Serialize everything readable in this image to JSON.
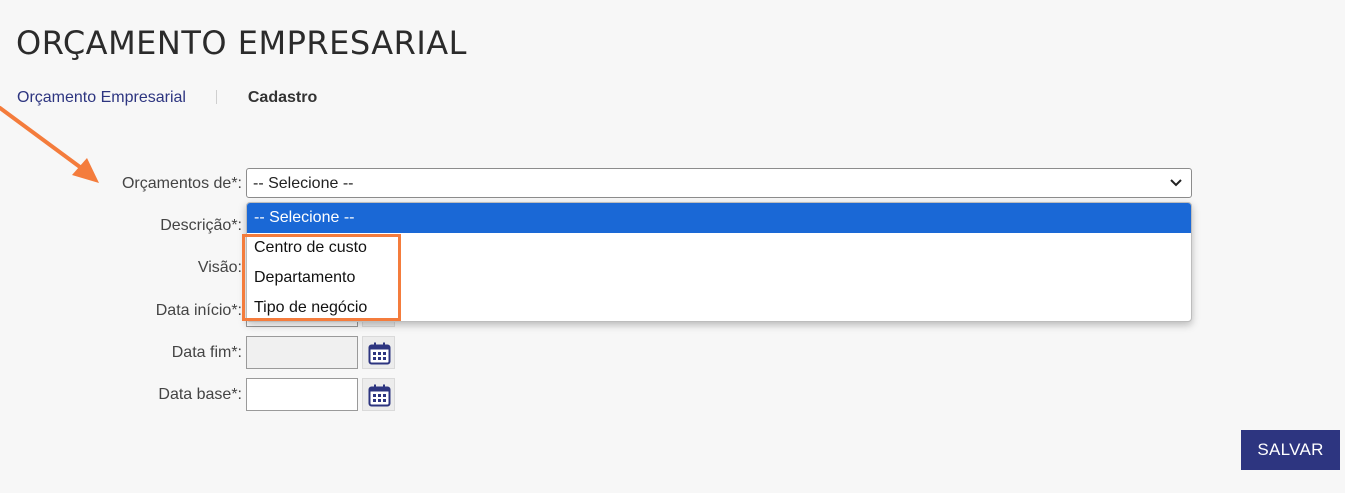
{
  "page": {
    "title": "ORÇAMENTO EMPRESARIAL"
  },
  "breadcrumb": {
    "link": "Orçamento Empresarial",
    "current": "Cadastro"
  },
  "form": {
    "orcamentos_de": {
      "label": "Orçamentos de*:",
      "value": "-- Selecione --",
      "options": [
        "-- Selecione --",
        "Centro de custo",
        "Departamento",
        "Tipo de negócio"
      ]
    },
    "descricao": {
      "label": "Descrição*:"
    },
    "visao": {
      "label": "Visão:"
    },
    "data_inicio": {
      "label": "Data início*:"
    },
    "data_fim": {
      "label": "Data fim*:"
    },
    "data_base": {
      "label": "Data base*:"
    }
  },
  "actions": {
    "save_label": "SALVAR"
  },
  "colors": {
    "accent": "#2d3580",
    "highlight": "#f47c3c",
    "selected_option": "#1a68d6"
  },
  "icons": {
    "calendar": "calendar-icon",
    "chevron": "chevron-down-icon"
  }
}
